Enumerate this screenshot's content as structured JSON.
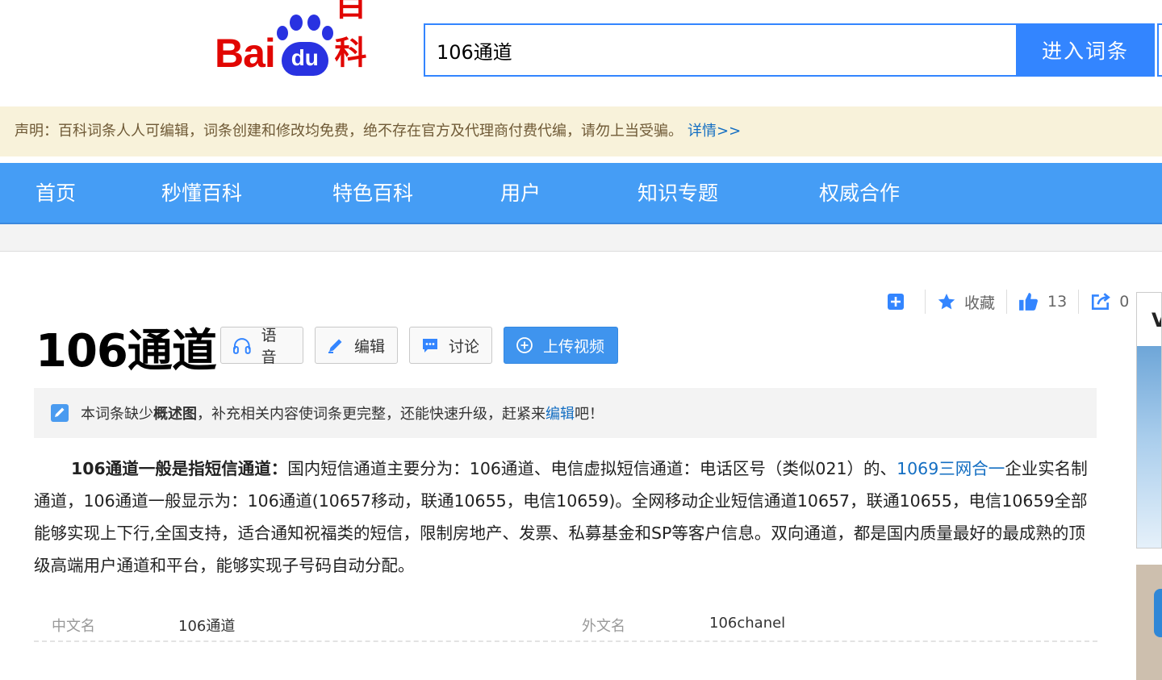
{
  "header": {
    "logo_latin": "Bai",
    "logo_paw_text": "du",
    "logo_cn": "百科",
    "search_value": "106通道",
    "search_button": "进入词条"
  },
  "notice": {
    "text": "声明：百科词条人人可编辑，词条创建和修改均免费，绝不存在官方及代理商付费代编，请勿上当受骗。",
    "link": "详情>>"
  },
  "nav": {
    "items": [
      "首页",
      "秒懂百科",
      "特色百科",
      "用户",
      "知识专题",
      "权威合作"
    ]
  },
  "tools": {
    "favorite_label": "收藏",
    "like_count": "13",
    "share_count": "0"
  },
  "title": "106通道",
  "title_buttons": {
    "voice": "语音",
    "edit": "编辑",
    "discuss": "讨论",
    "upload_video": "上传视频"
  },
  "tip": {
    "pre": "本词条缺少",
    "bold": "概述图",
    "mid": "，补充相关内容使词条更完整，还能快速升级，赶紧来",
    "link": "编辑",
    "post": "吧！"
  },
  "summary": {
    "lead": "106通道一般是指短信通道：",
    "text1": "国内短信通道主要分为：106通道、电信虚拟短信通道：电话区号（类似021）的、",
    "link": "1069三网合一",
    "text2": "企业实名制通道，106通道一般显示为：106通道(10657移动，联通10655，电信10659)。全网移动企业短信通道10657，联通10655，电信10659全部能够实现上下行,全国支持，适合通知祝福类的短信，限制房地产、发票、私募基金和SP等客户信息。双向通道，都是国内质量最好的最成熟的顶级高端用户通道和平台，能够实现子号码自动分配。"
  },
  "basic_info": [
    {
      "key": "中文名",
      "value": "106通道"
    },
    {
      "key": "外文名",
      "value": "106chanel"
    }
  ],
  "sidebar": {
    "letter": "V"
  },
  "colors": {
    "brand_blue": "#3385ff",
    "nav_blue": "#459df5",
    "brand_red": "#e10602",
    "link_blue": "#136ec2",
    "notice_bg": "#f8f2da"
  }
}
